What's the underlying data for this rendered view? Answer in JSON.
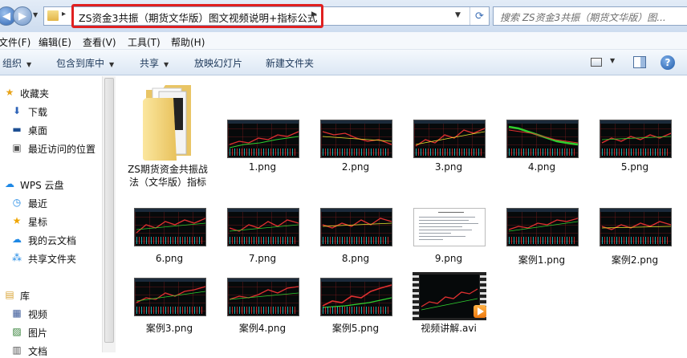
{
  "address": {
    "path": "ZS资金3共振（期货文华版）图文视频说明+指标公式",
    "search_placeholder": "搜索 ZS资金3共振（期货文华版）图..."
  },
  "menu": [
    "文件(F)",
    "编辑(E)",
    "查看(V)",
    "工具(T)",
    "帮助(H)"
  ],
  "commands": {
    "organize": "组织",
    "include_library": "包含到库中",
    "share": "共享",
    "slideshow": "放映幻灯片",
    "new_folder": "新建文件夹"
  },
  "nav": {
    "favorites": "收藏夹",
    "downloads": "下载",
    "desktop": "桌面",
    "recent_places": "最近访问的位置",
    "wps_cloud": "WPS 云盘",
    "recent": "最近",
    "starred": "星标",
    "my_cloud_docs": "我的云文档",
    "shared_folder": "共享文件夹",
    "libraries": "库",
    "videos": "视频",
    "pictures": "图片",
    "documents": "文档"
  },
  "files": {
    "folder": "ZS期货资金共振战法（文华版）指标",
    "f1": "1.png",
    "f2": "2.png",
    "f3": "3.png",
    "f4": "4.png",
    "f5": "5.png",
    "f6": "6.png",
    "f7": "7.png",
    "f8": "8.png",
    "f9": "9.png",
    "c1": "案例1.png",
    "c2": "案例2.png",
    "c3": "案例3.png",
    "c4": "案例4.png",
    "c5": "案例5.png",
    "video": "视频讲解.avi"
  },
  "colors": {
    "highlight_box": "#e02020",
    "chart_bg": "#06090a",
    "candle_up": "#e03030",
    "candle_down": "#1fc7c7"
  }
}
